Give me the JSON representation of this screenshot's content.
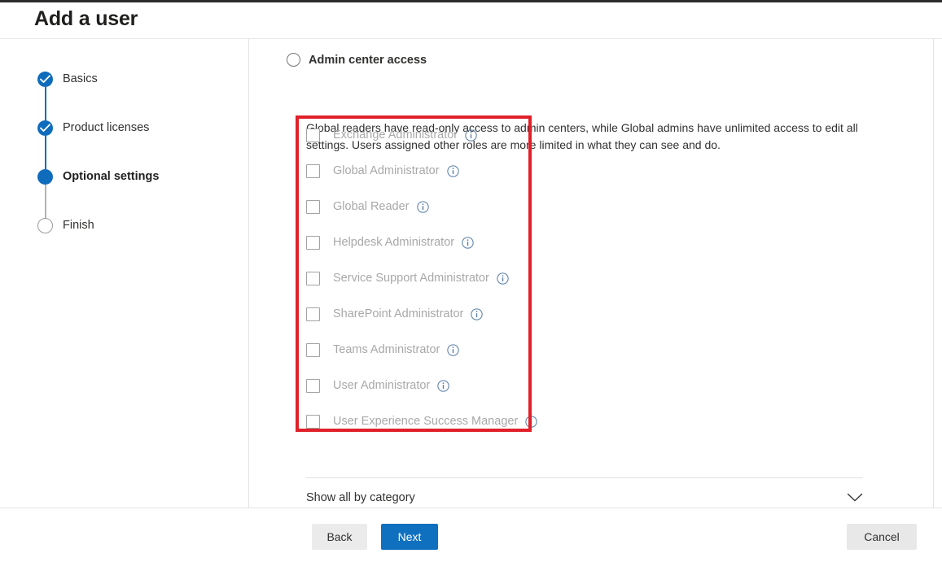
{
  "header": {
    "title": "Add a user"
  },
  "stepper": {
    "items": [
      {
        "label": "Basics",
        "state": "done"
      },
      {
        "label": "Product licenses",
        "state": "done"
      },
      {
        "label": "Optional settings",
        "state": "active"
      },
      {
        "label": "Finish",
        "state": "pending"
      }
    ]
  },
  "main": {
    "access_option": {
      "label": "Admin center access",
      "selected": false,
      "radio_icon": "radio-unselected-icon"
    },
    "description": "Global readers have read-only access to admin centers, while Global admins have unlimited access to edit all settings. Users assigned other roles are more limited in what they can see and do.",
    "roles": [
      {
        "label": "Exchange Administrator",
        "checked": false,
        "info_icon": "info-icon"
      },
      {
        "label": "Global Administrator",
        "checked": false,
        "info_icon": "info-icon"
      },
      {
        "label": "Global Reader",
        "checked": false,
        "info_icon": "info-icon"
      },
      {
        "label": "Helpdesk Administrator",
        "checked": false,
        "info_icon": "info-icon"
      },
      {
        "label": "Service Support Administrator",
        "checked": false,
        "info_icon": "info-icon"
      },
      {
        "label": "SharePoint Administrator",
        "checked": false,
        "info_icon": "info-icon"
      },
      {
        "label": "Teams Administrator",
        "checked": false,
        "info_icon": "info-icon"
      },
      {
        "label": "User Administrator",
        "checked": false,
        "info_icon": "info-icon"
      },
      {
        "label": "User Experience Success Manager",
        "checked": false,
        "info_icon": "info-icon"
      }
    ],
    "show_all": {
      "label": "Show all by category",
      "expanded": false,
      "chevron_icon": "chevron-down-icon"
    }
  },
  "footer": {
    "back_label": "Back",
    "next_label": "Next",
    "cancel_label": "Cancel"
  },
  "annotation": {
    "shape": "rectangle",
    "color": "#e0202a"
  },
  "colors": {
    "accent": "#0f6cbd",
    "primary_button": "#1070c0",
    "annotation_red": "#e0202a",
    "disabled_text": "#a8a8a8",
    "text": "#323130"
  }
}
